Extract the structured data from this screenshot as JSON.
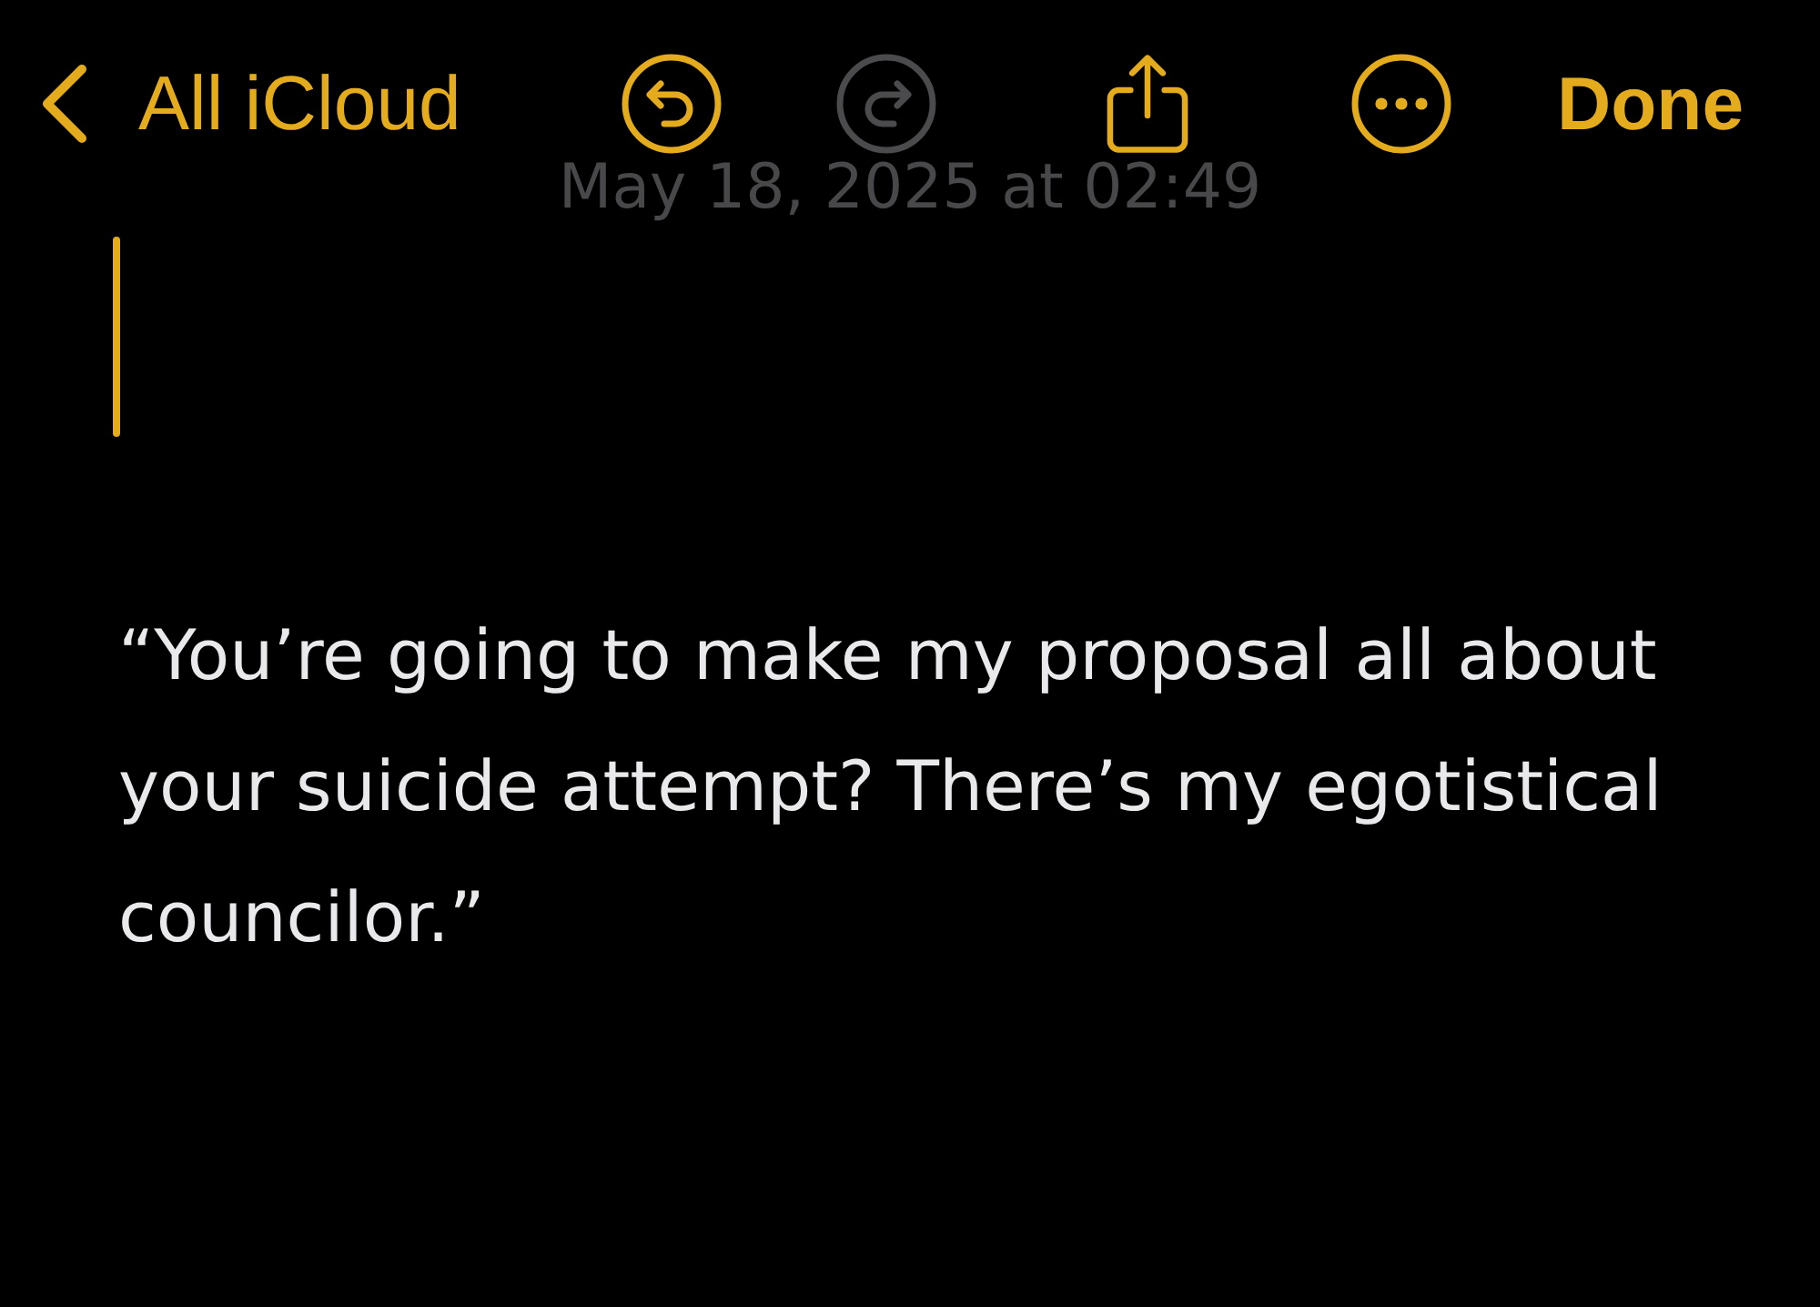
{
  "toolbar": {
    "back": {
      "label": "All iCloud"
    },
    "actions": [
      {
        "kind": "undo",
        "disabled": false
      },
      {
        "kind": "redo",
        "disabled": true
      },
      {
        "kind": "share",
        "disabled": false
      },
      {
        "kind": "more",
        "disabled": false
      }
    ],
    "done": {
      "label": "Done"
    }
  },
  "note": {
    "date": "May 18, 2025 at 02:49",
    "paragraphs": [
      "“You’re going to make my proposal all about your suicide attempt? There’s my egotistical councilor.”"
    ]
  }
}
